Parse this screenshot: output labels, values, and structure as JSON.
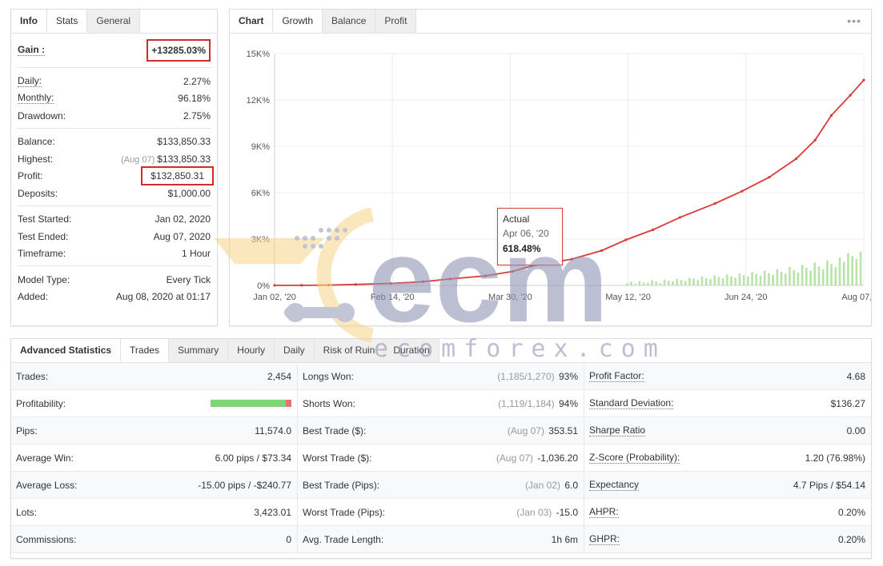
{
  "info": {
    "tabs": [
      "Info",
      "Stats",
      "General"
    ],
    "gain": {
      "label": "Gain :",
      "value": "+13285.03%"
    },
    "daily": {
      "label": "Daily:",
      "value": "2.27%"
    },
    "monthly": {
      "label": "Monthly:",
      "value": "96.18%"
    },
    "drawdown": {
      "label": "Drawdown:",
      "value": "2.75%"
    },
    "balance": {
      "label": "Balance:",
      "value": "$133,850.33"
    },
    "highest": {
      "label": "Highest:",
      "sub": "(Aug 07)",
      "value": "$133,850.33"
    },
    "profit": {
      "label": "Profit:",
      "value": "$132,850.31"
    },
    "deposits": {
      "label": "Deposits:",
      "value": "$1,000.00"
    },
    "test_started": {
      "label": "Test Started:",
      "value": "Jan 02, 2020"
    },
    "test_ended": {
      "label": "Test Ended:",
      "value": "Aug 07, 2020"
    },
    "timeframe": {
      "label": "Timeframe:",
      "value": "1 Hour"
    },
    "model_type": {
      "label": "Model Type:",
      "value": "Every Tick"
    },
    "added": {
      "label": "Added:",
      "value": "Aug 08, 2020 at 01:17"
    }
  },
  "chart_panel": {
    "tabs": [
      "Chart",
      "Growth",
      "Balance",
      "Profit"
    ],
    "menu_icon": "ellipsis-icon",
    "tooltip": {
      "series": "Actual",
      "date": "Apr 06, '20",
      "value": "618.48%"
    }
  },
  "chart_data": {
    "type": "line",
    "y_ticks": [
      "0%",
      "3K%",
      "6K%",
      "9K%",
      "12K%",
      "15K%"
    ],
    "x_ticks": [
      "Jan 02, '20",
      "Feb 14, '20",
      "Mar 30, '20",
      "May 12, '20",
      "Jun 24, '20",
      "Aug 07, '20"
    ],
    "ylim": [
      0,
      15000
    ],
    "line_color": "#d93b3b",
    "bar_color": "#b9e3a8",
    "growth_days": [
      0,
      10,
      20,
      30,
      43,
      55,
      65,
      78,
      88,
      95,
      110,
      121,
      130,
      140,
      150,
      163,
      173,
      183,
      193,
      200,
      206,
      213,
      218
    ],
    "growth_values": [
      0,
      5,
      20,
      60,
      130,
      240,
      420,
      618,
      900,
      1250,
      1700,
      2250,
      2950,
      3600,
      4400,
      5300,
      6100,
      7000,
      8200,
      9400,
      11000,
      12300,
      13285
    ],
    "bars_start_day": 130,
    "bars_values": [
      150,
      250,
      120,
      300,
      200,
      180,
      350,
      260,
      140,
      400,
      320,
      280,
      450,
      380,
      300,
      520,
      460,
      360,
      600,
      500,
      420,
      680,
      560,
      480,
      750,
      620,
      530,
      820,
      700,
      600,
      900,
      780,
      660,
      1000,
      850,
      720,
      1100,
      930,
      800,
      1250,
      1050,
      880,
      1400,
      1200,
      1000,
      1550,
      1300,
      1100,
      1700,
      1450,
      1250,
      1900,
      1600,
      2200,
      2000,
      1800,
      2300
    ]
  },
  "adv": {
    "tabs": [
      "Advanced Statistics",
      "Trades",
      "Summary",
      "Hourly",
      "Daily",
      "Risk of Ruin",
      "Duration"
    ],
    "col1": [
      {
        "label": "Trades:",
        "value": "2,454"
      },
      {
        "label": "Profitability:",
        "value": "",
        "bar_positive_fraction": 0.93
      },
      {
        "label": "Pips:",
        "value": "11,574.0"
      },
      {
        "label": "Average Win:",
        "value": "6.00 pips / $73.34"
      },
      {
        "label": "Average Loss:",
        "value": "-15.00 pips / -$240.77"
      },
      {
        "label": "Lots:",
        "value": "3,423.01"
      },
      {
        "label": "Commissions:",
        "value": "0"
      }
    ],
    "col2": [
      {
        "label": "Longs Won:",
        "sub": "(1,185/1,270)",
        "value": "93%"
      },
      {
        "label": "Shorts Won:",
        "sub": "(1,119/1,184)",
        "value": "94%"
      },
      {
        "label": "Best Trade ($):",
        "sub": "(Aug 07)",
        "value": "353.51"
      },
      {
        "label": "Worst Trade ($):",
        "sub": "(Aug 07)",
        "value": "-1,036.20"
      },
      {
        "label": "Best Trade (Pips):",
        "sub": "(Jan 02)",
        "value": "6.0"
      },
      {
        "label": "Worst Trade (Pips):",
        "sub": "(Jan 03)",
        "value": "-15.0"
      },
      {
        "label": "Avg. Trade Length:",
        "sub": "",
        "value": "1h 6m"
      }
    ],
    "col3": [
      {
        "label": "Profit Factor:",
        "value": "4.68"
      },
      {
        "label": "Standard Deviation:",
        "value": "$136.27"
      },
      {
        "label": "Sharpe Ratio",
        "value": "0.00"
      },
      {
        "label": "Z-Score (Probability):",
        "value": "1.20 (76.98%)"
      },
      {
        "label": "Expectancy",
        "value": "4.7 Pips / $54.14"
      },
      {
        "label": "AHPR:",
        "value": "0.20%"
      },
      {
        "label": "GHPR:",
        "value": "0.20%"
      }
    ]
  },
  "watermark": {
    "text": "ecomforex.com",
    "brand": "ecm"
  }
}
